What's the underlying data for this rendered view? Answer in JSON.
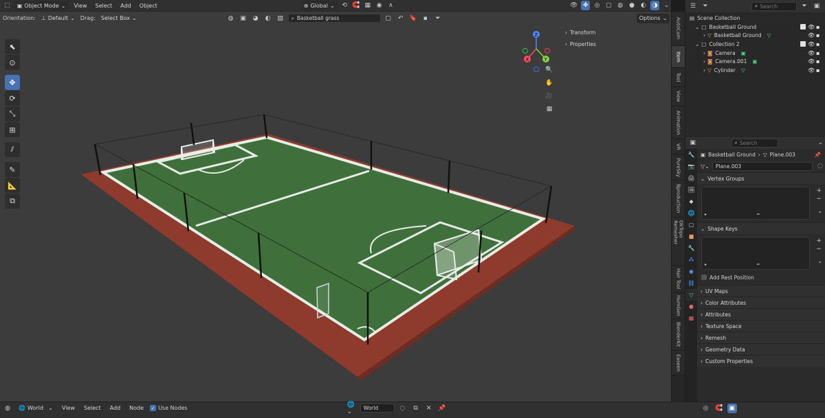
{
  "header": {
    "mode": "Object Mode",
    "menus": [
      "View",
      "Select",
      "Add",
      "Object"
    ],
    "transform_orientation": "Global",
    "options": "Options"
  },
  "subheader": {
    "orientation_label": "Orientation:",
    "orientation_value": "Default",
    "drag_label": "Drag:",
    "drag_value": "Select Box",
    "search_value": "Basketball grass"
  },
  "npanel": {
    "transform": "Transform",
    "properties": "Properties"
  },
  "side_tabs": [
    "AutoCam",
    "Item",
    "Tool",
    "View",
    "Animation",
    "VR",
    "PureSky",
    "Bproduction",
    "OkTopo Remesher",
    "Hair Tool",
    "HumGen",
    "BlenderKit",
    "Easeen"
  ],
  "outliner": {
    "search_placeholder": "Search",
    "scene_collection": "Scene Collection",
    "items": [
      {
        "name": "Basketball Ground",
        "indent": 0
      },
      {
        "name": "Basketball Ground",
        "indent": 1
      },
      {
        "name": "Collection 2",
        "indent": 0
      },
      {
        "name": "Camera",
        "indent": 1
      },
      {
        "name": "Camera.001",
        "indent": 1
      },
      {
        "name": "Cylinder",
        "indent": 1
      }
    ]
  },
  "properties": {
    "search_placeholder": "Search",
    "breadcrumb_object": "Basketball Ground",
    "breadcrumb_data": "Plane.003",
    "mesh_name": "Plane.003",
    "vertex_groups": "Vertex Groups",
    "shape_keys": "Shape Keys",
    "add_rest_position": "Add Rest Position",
    "panels": [
      "UV Maps",
      "Color Attributes",
      "Attributes",
      "Texture Space",
      "Remesh",
      "Geometry Data",
      "Custom Properties"
    ]
  },
  "bottom": {
    "editor": "World",
    "menus": [
      "View",
      "Select",
      "Add",
      "Node"
    ],
    "use_nodes": "Use Nodes",
    "world_name": "World"
  },
  "colors": {
    "accent": "#4772b3",
    "viewport_bg": "#3c3c3c",
    "grass": "#3f6f3a",
    "track": "#8e3b2d",
    "line": "#e6ece6"
  }
}
